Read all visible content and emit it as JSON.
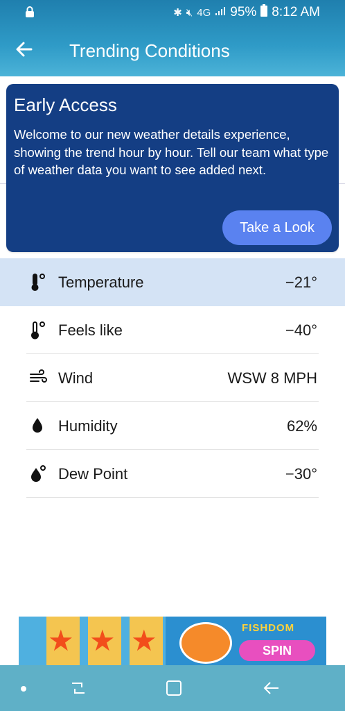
{
  "status_bar": {
    "battery": "95%",
    "time": "8:12 AM",
    "network": "4G"
  },
  "app_bar": {
    "title": "Trending Conditions"
  },
  "promo": {
    "title": "Early Access",
    "body": "Welcome to our new weather details experience, showing the trend hour by hour. Tell our team what type of weather data you want to see added next.",
    "button": "Take a Look",
    "color": "#143e84"
  },
  "conditions": [
    {
      "label": "Temperature",
      "value": "−21°",
      "icon": "thermometer-icon",
      "selected": true
    },
    {
      "label": "Feels like",
      "value": "−40°",
      "icon": "thermometer-outline-icon",
      "selected": false
    },
    {
      "label": "Wind",
      "value": "WSW 8 MPH",
      "icon": "wind-icon",
      "selected": false
    },
    {
      "label": "Humidity",
      "value": "62%",
      "icon": "water-drop-icon",
      "selected": false
    },
    {
      "label": "Dew Point",
      "value": "−30°",
      "icon": "dew-point-icon",
      "selected": false
    }
  ],
  "ad": {
    "brand": "FISHDOM",
    "cta": "SPIN"
  },
  "colors": {
    "header": "#2f9bc7",
    "selected_row": "#d4e3f5",
    "button": "#5a82f0"
  }
}
